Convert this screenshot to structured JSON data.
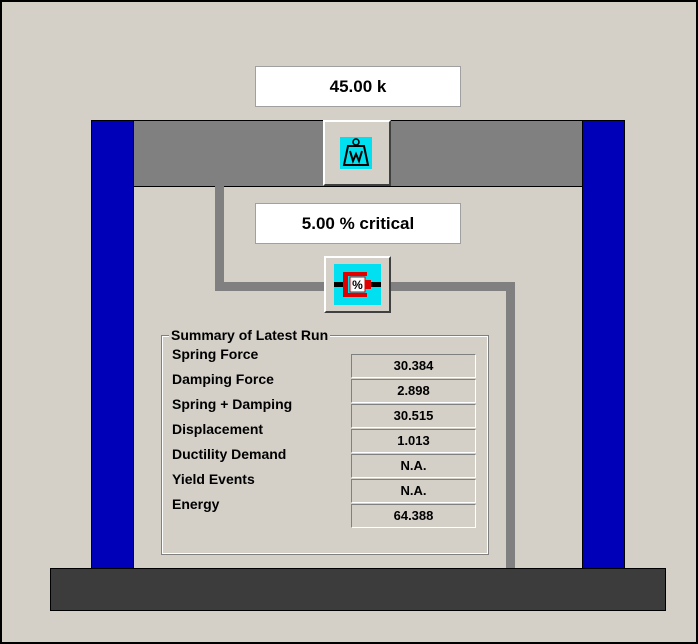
{
  "weight": {
    "value": "45.00 k",
    "icon": "weight-icon"
  },
  "damping": {
    "value": "5.00 % critical",
    "icon": "damper-icon"
  },
  "summary": {
    "title": "Summary of Latest Run",
    "rows": [
      {
        "label": "Spring Force",
        "value": "30.384"
      },
      {
        "label": "Damping Force",
        "value": "2.898"
      },
      {
        "label": "Spring + Damping",
        "value": "30.515"
      },
      {
        "label": "Displacement",
        "value": "1.013"
      },
      {
        "label": "Ductility Demand",
        "value": "N.A."
      },
      {
        "label": "Yield Events",
        "value": "N.A."
      },
      {
        "label": "Energy",
        "value": "64.388"
      }
    ]
  },
  "colors": {
    "columns": "#0000b8",
    "beam": "#808080",
    "base": "#3c3c3c",
    "icon_bg": "#00e0f0",
    "damper_red": "#e00000"
  }
}
